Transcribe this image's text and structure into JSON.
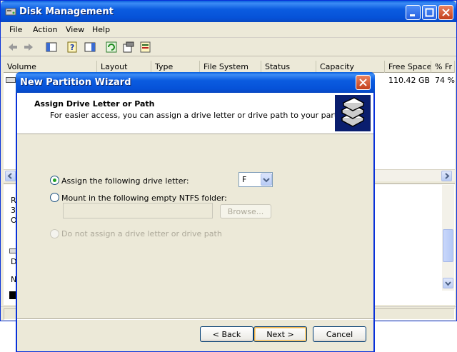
{
  "main_window": {
    "title": "Disk Management",
    "menu": [
      "File",
      "Action",
      "View",
      "Help"
    ],
    "columns": [
      "Volume",
      "Layout",
      "Type",
      "File System",
      "Status",
      "Capacity",
      "Free Space",
      "% Fr"
    ],
    "row": {
      "free_space": "110.42 GB",
      "percent_free": "74 %"
    },
    "lower_pane_letters": [
      "R",
      "3",
      "O",
      "D",
      "N"
    ]
  },
  "wizard": {
    "title": "New Partition Wizard",
    "header_title": "Assign Drive Letter or Path",
    "header_subtitle": "For easier access, you can assign a drive letter or drive path to your partition.",
    "option_assign": "Assign the following drive letter:",
    "option_mount": "Mount in the following empty NTFS folder:",
    "option_none": "Do not assign a drive letter or drive path",
    "drive_letter": "F",
    "browse_label": "Browse...",
    "back_label": "< Back",
    "next_label": "Next >",
    "cancel_label": "Cancel"
  },
  "colors": {
    "titlebar": "#0a5fdd",
    "dialog_bg": "#ece9d8",
    "radio_dot": "#21a121"
  }
}
